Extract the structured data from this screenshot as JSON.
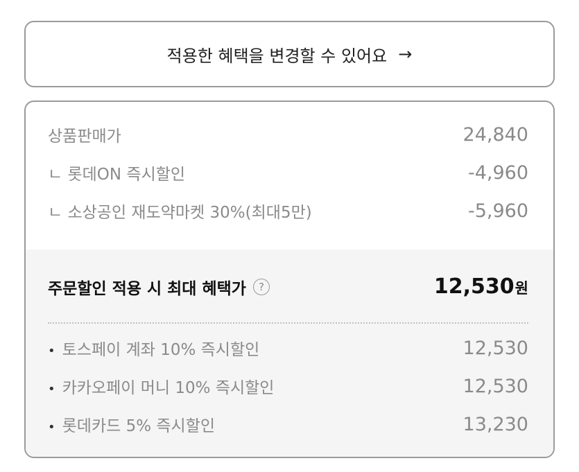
{
  "change_button": {
    "label": "적용한 혜택을 변경할 수 있어요",
    "arrow": "→"
  },
  "price_rows": [
    {
      "label": "상품판매가",
      "value": "24,840"
    },
    {
      "label": "ㄴ 롯데ON 즉시할인",
      "value": "-4,960"
    },
    {
      "label": "ㄴ 소상공인 재도약마켓 30%(최대5만)",
      "value": "-5,960"
    }
  ],
  "total": {
    "label": "주문할인 적용 시 최대 혜택가",
    "help_icon": "?",
    "value": "12,530",
    "unit": "원"
  },
  "payment_rows": [
    {
      "bullet": "•",
      "label": "토스페이 계좌 10% 즉시할인",
      "value": "12,530"
    },
    {
      "bullet": "•",
      "label": "카카오페이 머니 10% 즉시할인",
      "value": "12,530"
    },
    {
      "bullet": "•",
      "label": "롯데카드 5% 즉시할인",
      "value": "13,230"
    }
  ]
}
